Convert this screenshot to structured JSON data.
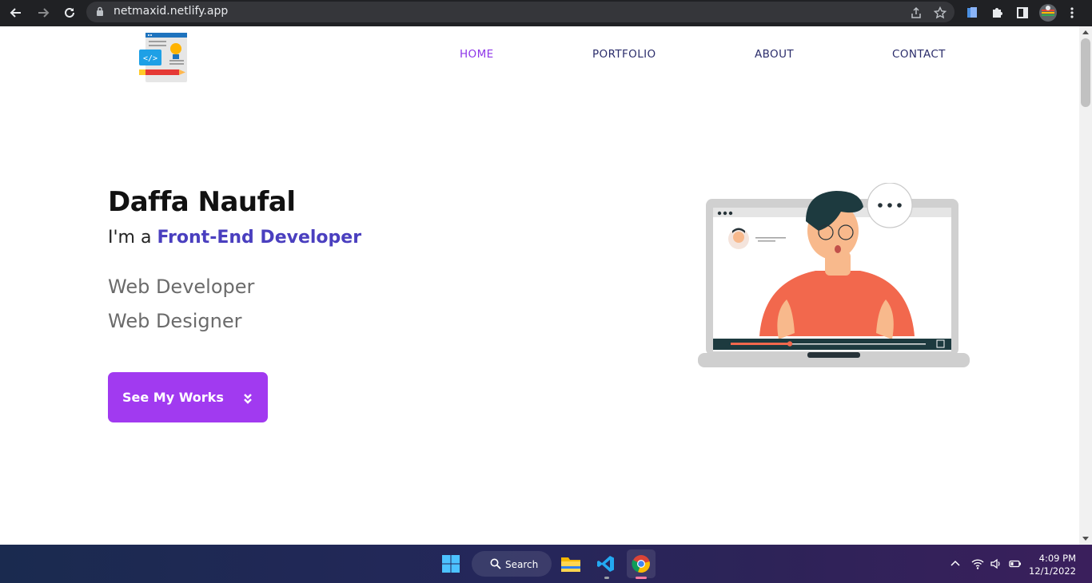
{
  "browser": {
    "url": "netmaxid.netlify.app"
  },
  "nav": {
    "items": [
      {
        "label": "HOME",
        "active": true
      },
      {
        "label": "PORTFOLIO",
        "active": false
      },
      {
        "label": "ABOUT",
        "active": false
      },
      {
        "label": "CONTACT",
        "active": false
      }
    ]
  },
  "hero": {
    "name": "Daffa Naufal",
    "role_prefix": "I'm a ",
    "role_highlight": "Front-End Developer",
    "skills": [
      "Web Developer",
      "Web Designer"
    ],
    "cta_label": "See My Works"
  },
  "taskbar": {
    "search_label": "Search",
    "time": "4:09 PM",
    "date": "12/1/2022"
  },
  "colors": {
    "accent": "#a13af0",
    "nav_active": "#8e36e8",
    "highlight": "#4a3fbf",
    "chrome": "#202124"
  }
}
